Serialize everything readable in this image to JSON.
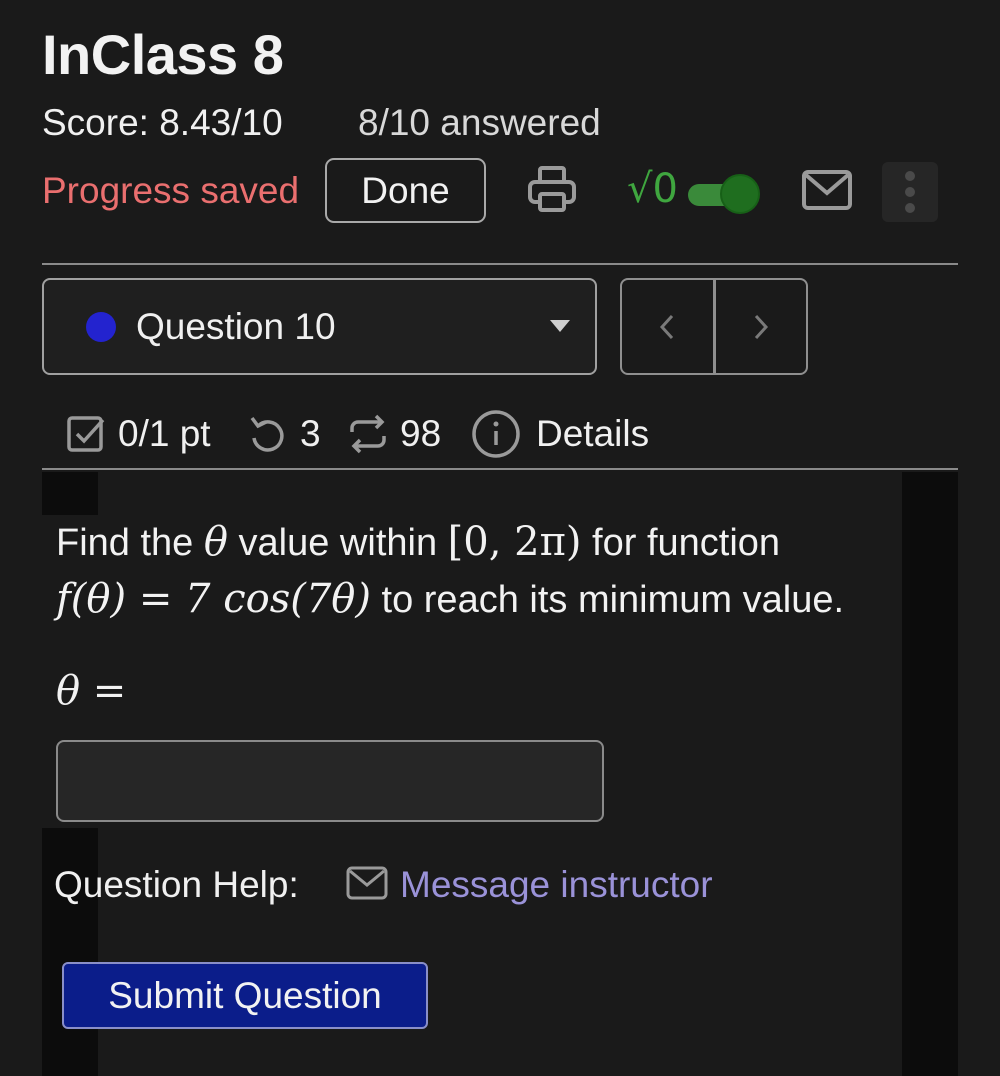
{
  "header": {
    "title": "InClass 8",
    "score": "Score: 8.43/10",
    "answered": "8/10 answered",
    "progress_status": "Progress saved",
    "done_label": "Done",
    "sqrt_label": "√0",
    "toggle_on": true
  },
  "question_selector": {
    "label": "Question 10",
    "status_color": "#2323cf"
  },
  "nav": {
    "prev_icon": "chevron-left-icon",
    "next_icon": "chevron-right-icon"
  },
  "meta": {
    "points": "0/1 pt",
    "retries": "3",
    "attempts": "98",
    "details_label": "Details"
  },
  "question": {
    "text_1": "Find the",
    "theta": "θ",
    "text_2": "value within",
    "interval": "[0, 2π)",
    "text_3": "for function",
    "function": "f(θ) = 7 cos(7θ)",
    "text_4": "to reach its minimum value.",
    "answer_prompt": "θ =",
    "answer_value": ""
  },
  "help": {
    "label": "Question Help:",
    "link": "Message instructor"
  },
  "submit_label": "Submit Question",
  "colors": {
    "progress_saved": "#ea6f6f",
    "toggle_green": "#3a8a3a",
    "link": "#9a92d8",
    "submit_bg": "#0b1d8a"
  }
}
